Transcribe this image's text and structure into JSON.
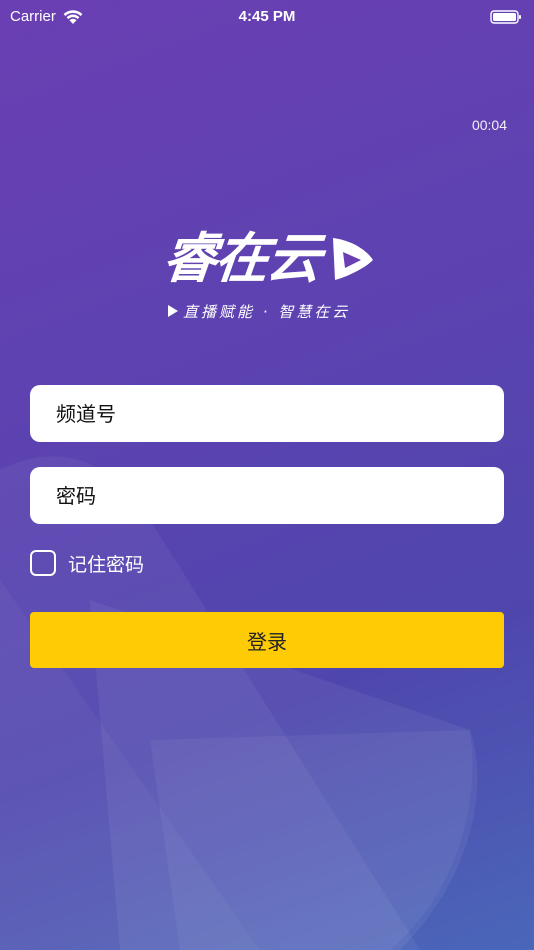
{
  "status_bar": {
    "carrier": "Carrier",
    "time": "4:45 PM"
  },
  "timer": "00:04",
  "logo": {
    "text": "睿在云",
    "slogan": "直播赋能 · 智慧在云"
  },
  "form": {
    "channel_placeholder": "频道号",
    "password_placeholder": "密码",
    "remember_label": "记住密码",
    "remember_checked": false,
    "login_label": "登录"
  },
  "colors": {
    "background_top": "#6a3fb3",
    "background_bottom": "#4a67b9",
    "login_button": "#ffcb05",
    "field_background": "#ffffff"
  },
  "icons": [
    "wifi-icon",
    "battery-icon",
    "play-icon",
    "checkbox-icon"
  ]
}
